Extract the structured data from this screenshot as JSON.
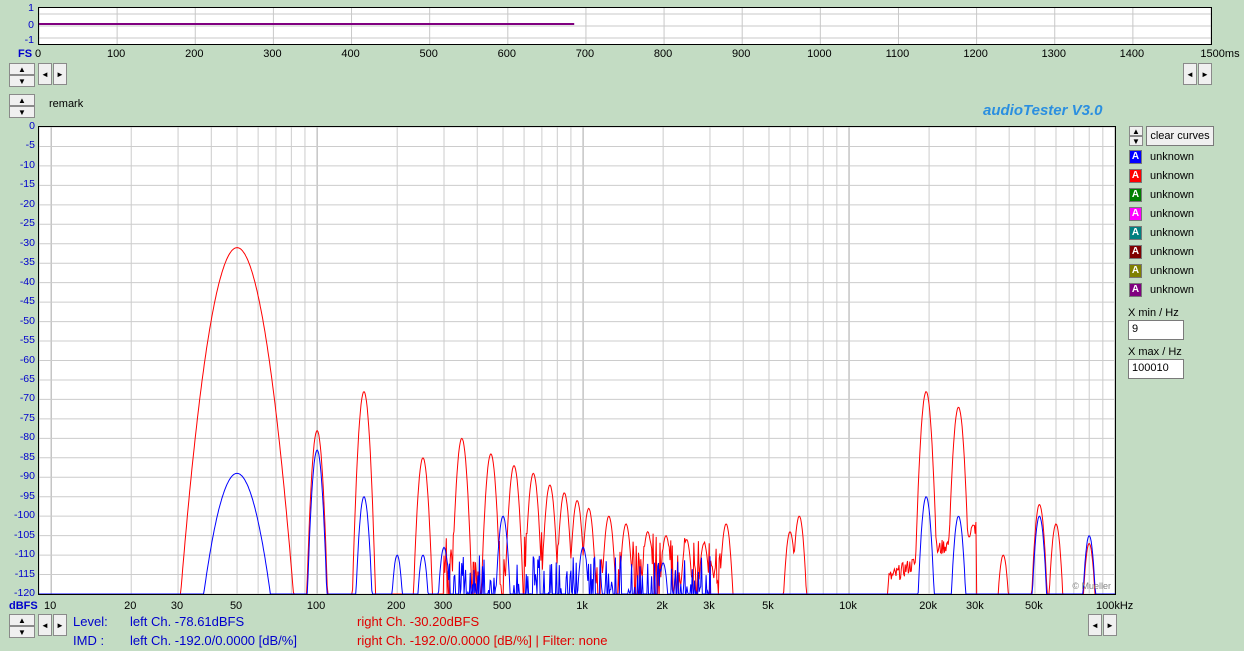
{
  "app": {
    "title": "audioTester  V3.0",
    "remark": "remark",
    "copyright": "© Mueller"
  },
  "scope": {
    "unit_label": "FS",
    "y_ticks": [
      "1",
      "0",
      "-1"
    ],
    "x_ticks": [
      "0",
      "100",
      "200",
      "300",
      "400",
      "500",
      "600",
      "700",
      "800",
      "900",
      "1000",
      "1100",
      "1200",
      "1300",
      "1400",
      "1500ms"
    ],
    "trace_end_ms": 685
  },
  "spectrum": {
    "y_unit": "dBFS",
    "x_unit": "100kHz",
    "y_ticks": [
      "0",
      "-5",
      "-10",
      "-15",
      "-20",
      "-25",
      "-30",
      "-35",
      "-40",
      "-45",
      "-50",
      "-55",
      "-60",
      "-65",
      "-70",
      "-75",
      "-80",
      "-85",
      "-90",
      "-95",
      "-100",
      "-105",
      "-110",
      "-115",
      "-120"
    ],
    "x_ticks": [
      {
        "label": "10",
        "f": 10
      },
      {
        "label": "20",
        "f": 20
      },
      {
        "label": "30",
        "f": 30
      },
      {
        "label": "50",
        "f": 50
      },
      {
        "label": "100",
        "f": 100
      },
      {
        "label": "200",
        "f": 200
      },
      {
        "label": "300",
        "f": 300
      },
      {
        "label": "500",
        "f": 500
      },
      {
        "label": "1k",
        "f": 1000
      },
      {
        "label": "2k",
        "f": 2000
      },
      {
        "label": "3k",
        "f": 3000
      },
      {
        "label": "5k",
        "f": 5000
      },
      {
        "label": "10k",
        "f": 10000
      },
      {
        "label": "20k",
        "f": 20000
      },
      {
        "label": "30k",
        "f": 30000
      },
      {
        "label": "50k",
        "f": 50000
      }
    ]
  },
  "chart_data": {
    "type": "line",
    "xlabel": "",
    "ylabel": "dBFS",
    "xlim": [
      9,
      100010
    ],
    "ylim": [
      -120,
      0
    ],
    "x_scale": "log",
    "grid": true,
    "series": [
      {
        "color": "#ff0000",
        "peaks": [
          [
            50,
            -31
          ],
          [
            100,
            -78
          ],
          [
            150,
            -68
          ],
          [
            250,
            -85
          ],
          [
            350,
            -80
          ],
          [
            450,
            -84
          ],
          [
            550,
            -87
          ],
          [
            650,
            -89
          ],
          [
            750,
            -92
          ],
          [
            850,
            -94
          ],
          [
            950,
            -96
          ],
          [
            1050,
            -98
          ],
          [
            1250,
            -100
          ],
          [
            1450,
            -102
          ],
          [
            1750,
            -104
          ],
          [
            2050,
            -105
          ],
          [
            2450,
            -106
          ],
          [
            2850,
            -107
          ],
          [
            3450,
            -102
          ],
          [
            6000,
            -104
          ],
          [
            6500,
            -100
          ],
          [
            19500,
            -68
          ],
          [
            25800,
            -72
          ],
          [
            38000,
            -110
          ],
          [
            52000,
            -97
          ],
          [
            60000,
            -102
          ],
          [
            80000,
            -107
          ]
        ]
      },
      {
        "color": "#0000ff",
        "peaks": [
          [
            50,
            -89
          ],
          [
            100,
            -83
          ],
          [
            150,
            -95
          ],
          [
            200,
            -110
          ],
          [
            250,
            -110
          ],
          [
            300,
            -108
          ],
          [
            500,
            -100
          ],
          [
            1000,
            -108
          ],
          [
            2000,
            -112
          ],
          [
            19500,
            -95
          ],
          [
            25800,
            -100
          ],
          [
            52000,
            -100
          ],
          [
            80000,
            -105
          ]
        ]
      }
    ]
  },
  "controls": {
    "clear_curves": "clear curves",
    "curve_label": "unknown",
    "curve_colors": [
      "#0000ff",
      "#ff0000",
      "#008000",
      "#ff00ff",
      "#008080",
      "#800000",
      "#808000",
      "#800080"
    ],
    "xmin_label": "X min / Hz",
    "xmin_value": "9",
    "xmax_label": "X max / Hz",
    "xmax_value": "100010"
  },
  "status": {
    "level_label": "Level:",
    "imd_label": "IMD  :",
    "level_left": "left Ch. -78.61dBFS",
    "level_right": "right Ch. -30.20dBFS",
    "imd_left": "left Ch. -192.0/0.0000 [dB/%]",
    "imd_right": "right Ch. -192.0/0.0000 [dB/%] |   Filter: none"
  },
  "icons": {
    "spin_up": "▲",
    "spin_down": "▼",
    "arrow_left": "◄",
    "arrow_right": "►",
    "curve_marker": "A"
  }
}
